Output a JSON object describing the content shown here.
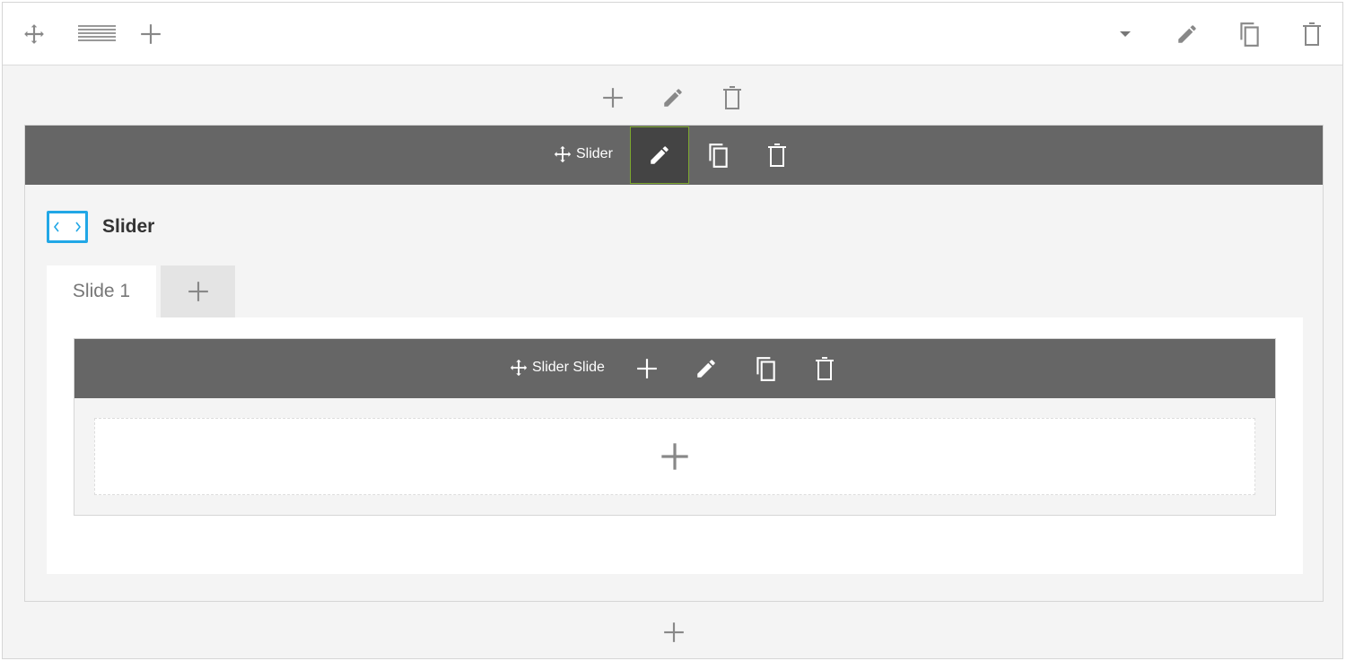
{
  "toolbar": {
    "left_icons": [
      "move-icon",
      "row-layout-icon",
      "plus-icon"
    ],
    "right_icons": [
      "caret-down-icon",
      "pencil-icon",
      "copy-icon",
      "trash-icon"
    ]
  },
  "row_controls": {
    "icons": [
      "plus-icon",
      "pencil-icon",
      "trash-icon"
    ]
  },
  "module": {
    "bar_label": "Slider",
    "title": "Slider",
    "icon": "slider-icon",
    "colors": {
      "bar": "#666666",
      "active_edit_bg": "#444444",
      "active_edit_border": "#7da82f",
      "icon_accent": "#21a7e6"
    }
  },
  "tabs": [
    {
      "label": "Slide 1",
      "active": true
    }
  ],
  "slide": {
    "bar_label": "Slider Slide"
  }
}
